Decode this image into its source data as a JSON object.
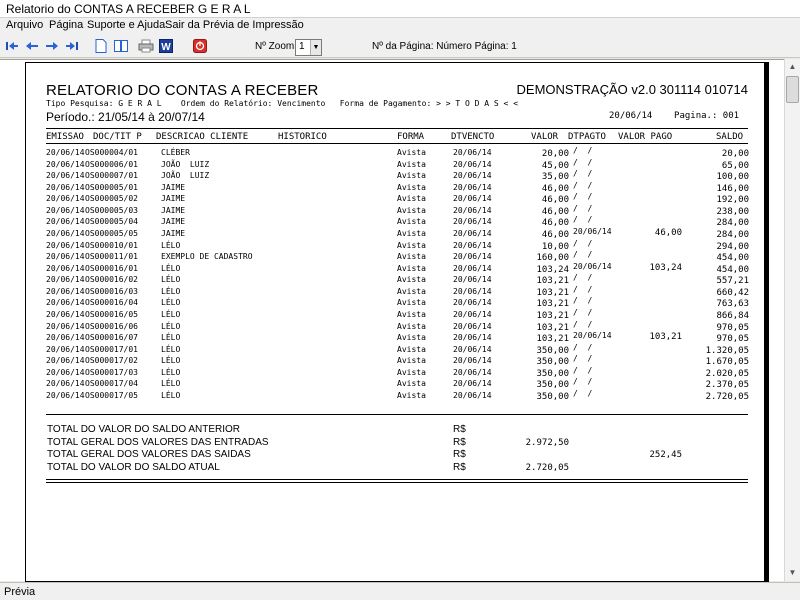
{
  "window": {
    "title": "Relatorio do CONTAS A RECEBER G E R A L"
  },
  "menu": [
    "Arquivo",
    "Página",
    "Suporte e Ajuda",
    "Sair da Prévia de Impressão"
  ],
  "toolbar": {
    "icons": [
      "first-page-icon",
      "previous-page-icon",
      "next-page-icon",
      "last-page-icon",
      "single-page-icon",
      "two-pages-icon",
      "printer-icon",
      "word-export-icon",
      "close-preview-icon"
    ],
    "zoom_label": "Nº Zoom",
    "zoom_value": "1",
    "page_label": "Nº da Página: Número Página: 1"
  },
  "report": {
    "title": "RELATORIO DO CONTAS A RECEBER",
    "demo": "DEMONSTRAÇÃO v2.0 301114 010714",
    "info": "Tipo Pesquisa: G E R A L    Ordem do Relatório: Vencimento   Forma de Pagamento: > > T O D A S < <",
    "period": "Período.: 21/05/14 à 20/07/14",
    "date_page": "20/06/14    Pagina.: 001",
    "headers": {
      "emissao": "EMISSAO",
      "doc": "DOC/TIT P",
      "descricao": "DESCRICAO CLIENTE",
      "historico": "HISTORICO",
      "forma": "FORMA",
      "dtvencto": "DTVENCTO",
      "valor": "VALOR",
      "dtpagto": "DTPAGTO",
      "valor_pago": "VALOR PAGO",
      "saldo": "SALDO"
    },
    "rows": [
      {
        "emissao": "20/06/14",
        "doc": "OS000004/01",
        "cliente": "CLÉBER",
        "forma": "Avista",
        "dtvencto": "20/06/14",
        "valor": "20,00",
        "dtpagto": "/  /",
        "valor_pago": "",
        "saldo": "20,00"
      },
      {
        "emissao": "20/06/14",
        "doc": "OS000006/01",
        "cliente": "JOÃO  LUIZ",
        "forma": "Avista",
        "dtvencto": "20/06/14",
        "valor": "45,00",
        "dtpagto": "/  /",
        "valor_pago": "",
        "saldo": "65,00"
      },
      {
        "emissao": "20/06/14",
        "doc": "OS000007/01",
        "cliente": "JOÃO  LUIZ",
        "forma": "Avista",
        "dtvencto": "20/06/14",
        "valor": "35,00",
        "dtpagto": "/  /",
        "valor_pago": "",
        "saldo": "100,00"
      },
      {
        "emissao": "20/06/14",
        "doc": "OS000005/01",
        "cliente": "JAIME",
        "forma": "Avista",
        "dtvencto": "20/06/14",
        "valor": "46,00",
        "dtpagto": "/  /",
        "valor_pago": "",
        "saldo": "146,00"
      },
      {
        "emissao": "20/06/14",
        "doc": "OS000005/02",
        "cliente": "JAIME",
        "forma": "Avista",
        "dtvencto": "20/06/14",
        "valor": "46,00",
        "dtpagto": "/  /",
        "valor_pago": "",
        "saldo": "192,00"
      },
      {
        "emissao": "20/06/14",
        "doc": "OS000005/03",
        "cliente": "JAIME",
        "forma": "Avista",
        "dtvencto": "20/06/14",
        "valor": "46,00",
        "dtpagto": "/  /",
        "valor_pago": "",
        "saldo": "238,00"
      },
      {
        "emissao": "20/06/14",
        "doc": "OS000005/04",
        "cliente": "JAIME",
        "forma": "Avista",
        "dtvencto": "20/06/14",
        "valor": "46,00",
        "dtpagto": "/  /",
        "valor_pago": "",
        "saldo": "284,00"
      },
      {
        "emissao": "20/06/14",
        "doc": "OS000005/05",
        "cliente": "JAIME",
        "forma": "Avista",
        "dtvencto": "20/06/14",
        "valor": "46,00",
        "dtpagto": "20/06/14",
        "valor_pago": "46,00",
        "saldo": "284,00"
      },
      {
        "emissao": "20/06/14",
        "doc": "OS000010/01",
        "cliente": "LÉLO",
        "forma": "Avista",
        "dtvencto": "20/06/14",
        "valor": "10,00",
        "dtpagto": "/  /",
        "valor_pago": "",
        "saldo": "294,00"
      },
      {
        "emissao": "20/06/14",
        "doc": "OS000011/01",
        "cliente": "EXEMPLO DE CADASTRO",
        "forma": "Avista",
        "dtvencto": "20/06/14",
        "valor": "160,00",
        "dtpagto": "/  /",
        "valor_pago": "",
        "saldo": "454,00"
      },
      {
        "emissao": "20/06/14",
        "doc": "OS000016/01",
        "cliente": "LÉLO",
        "forma": "Avista",
        "dtvencto": "20/06/14",
        "valor": "103,24",
        "dtpagto": "20/06/14",
        "valor_pago": "103,24",
        "saldo": "454,00"
      },
      {
        "emissao": "20/06/14",
        "doc": "OS000016/02",
        "cliente": "LÉLO",
        "forma": "Avista",
        "dtvencto": "20/06/14",
        "valor": "103,21",
        "dtpagto": "/  /",
        "valor_pago": "",
        "saldo": "557,21"
      },
      {
        "emissao": "20/06/14",
        "doc": "OS000016/03",
        "cliente": "LÉLO",
        "forma": "Avista",
        "dtvencto": "20/06/14",
        "valor": "103,21",
        "dtpagto": "/  /",
        "valor_pago": "",
        "saldo": "660,42"
      },
      {
        "emissao": "20/06/14",
        "doc": "OS000016/04",
        "cliente": "LÉLO",
        "forma": "Avista",
        "dtvencto": "20/06/14",
        "valor": "103,21",
        "dtpagto": "/  /",
        "valor_pago": "",
        "saldo": "763,63"
      },
      {
        "emissao": "20/06/14",
        "doc": "OS000016/05",
        "cliente": "LÉLO",
        "forma": "Avista",
        "dtvencto": "20/06/14",
        "valor": "103,21",
        "dtpagto": "/  /",
        "valor_pago": "",
        "saldo": "866,84"
      },
      {
        "emissao": "20/06/14",
        "doc": "OS000016/06",
        "cliente": "LÉLO",
        "forma": "Avista",
        "dtvencto": "20/06/14",
        "valor": "103,21",
        "dtpagto": "/  /",
        "valor_pago": "",
        "saldo": "970,05"
      },
      {
        "emissao": "20/06/14",
        "doc": "OS000016/07",
        "cliente": "LÉLO",
        "forma": "Avista",
        "dtvencto": "20/06/14",
        "valor": "103,21",
        "dtpagto": "20/06/14",
        "valor_pago": "103,21",
        "saldo": "970,05"
      },
      {
        "emissao": "20/06/14",
        "doc": "OS000017/01",
        "cliente": "LÉLO",
        "forma": "Avista",
        "dtvencto": "20/06/14",
        "valor": "350,00",
        "dtpagto": "/  /",
        "valor_pago": "",
        "saldo": "1.320,05"
      },
      {
        "emissao": "20/06/14",
        "doc": "OS000017/02",
        "cliente": "LÉLO",
        "forma": "Avista",
        "dtvencto": "20/06/14",
        "valor": "350,00",
        "dtpagto": "/  /",
        "valor_pago": "",
        "saldo": "1.670,05"
      },
      {
        "emissao": "20/06/14",
        "doc": "OS000017/03",
        "cliente": "LÉLO",
        "forma": "Avista",
        "dtvencto": "20/06/14",
        "valor": "350,00",
        "dtpagto": "/  /",
        "valor_pago": "",
        "saldo": "2.020,05"
      },
      {
        "emissao": "20/06/14",
        "doc": "OS000017/04",
        "cliente": "LÉLO",
        "forma": "Avista",
        "dtvencto": "20/06/14",
        "valor": "350,00",
        "dtpagto": "/  /",
        "valor_pago": "",
        "saldo": "2.370,05"
      },
      {
        "emissao": "20/06/14",
        "doc": "OS000017/05",
        "cliente": "LÉLO",
        "forma": "Avista",
        "dtvencto": "20/06/14",
        "valor": "350,00",
        "dtpagto": "/  /",
        "valor_pago": "",
        "saldo": "2.720,05"
      }
    ],
    "totals": [
      {
        "label": "TOTAL DO VALOR DO SALDO ANTERIOR",
        "currency": "R$",
        "v1": "",
        "v2": ""
      },
      {
        "label": "TOTAL GERAL DOS VALORES DAS ENTRADAS",
        "currency": "R$",
        "v1": "2.972,50",
        "v2": ""
      },
      {
        "label": "TOTAL GERAL DOS VALORES DAS SAIDAS",
        "currency": "R$",
        "v1": "",
        "v2": "252,45"
      },
      {
        "label": "TOTAL DO VALOR DO SALDO ATUAL",
        "currency": "R$",
        "v1": "2.720,05",
        "v2": ""
      }
    ]
  },
  "status": {
    "text": "Prévia"
  }
}
